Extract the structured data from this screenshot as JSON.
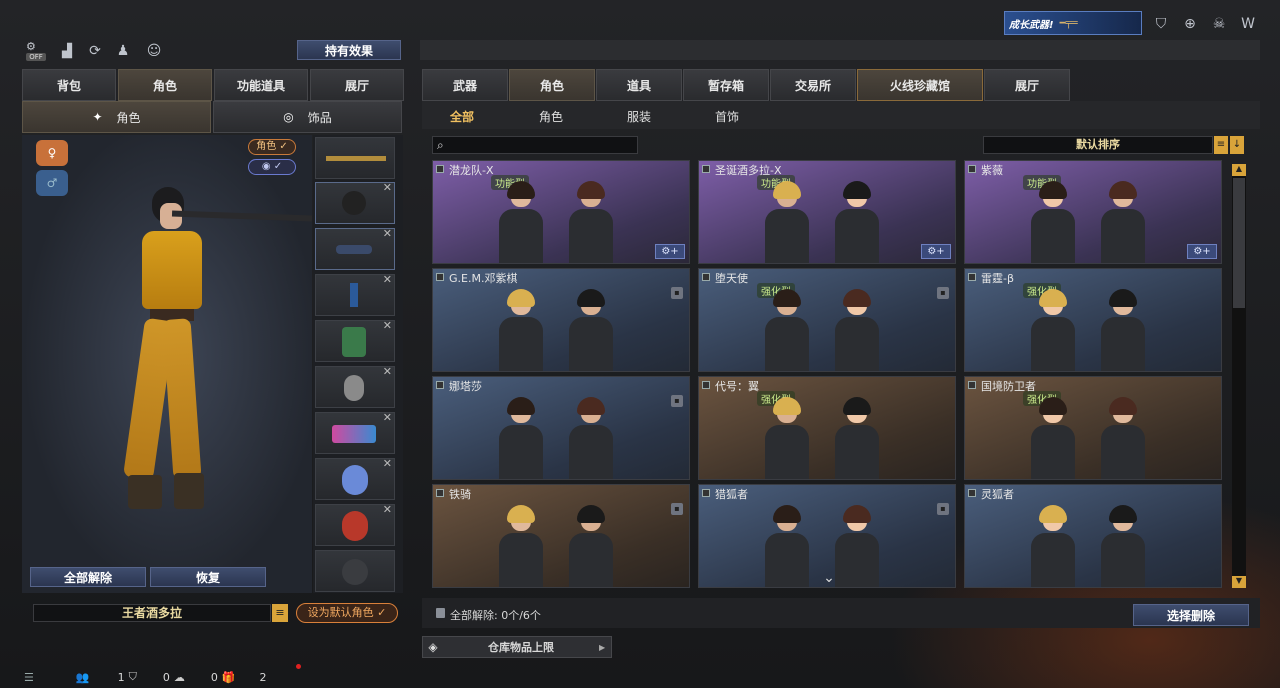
{
  "top_right": {
    "badge_text": "成长武器!"
  },
  "left_panel": {
    "effect_button": "持有效果",
    "off_label": "OFF",
    "tabs": [
      "背包",
      "角色",
      "功能道具",
      "展厅"
    ],
    "sub_tabs": [
      "角色",
      "饰品"
    ],
    "preview_tags": {
      "role": "角色 ✓",
      "eye": "✓"
    },
    "unequip_all": "全部解除",
    "restore": "恢复",
    "character_name": "王者酒多拉",
    "set_default": "设为默认角色 ✓"
  },
  "right_panel": {
    "tabs": [
      "武器",
      "角色",
      "道具",
      "暂存箱",
      "交易所",
      "火线珍藏馆",
      "展厅"
    ],
    "sub_tabs": [
      "全部",
      "角色",
      "服装",
      "首饰"
    ],
    "search_placeholder": "",
    "sort_label": "默认排序",
    "cards": [
      {
        "name": "潜龙队-X",
        "tag": "功能型",
        "theme": "purple"
      },
      {
        "name": "圣诞酒多拉-X",
        "tag": "功能型",
        "theme": "purple"
      },
      {
        "name": "紫薇",
        "tag": "功能型",
        "theme": "purple"
      },
      {
        "name": "G.E.M.邓紫棋",
        "tag": "",
        "theme": "blue"
      },
      {
        "name": "堕天使",
        "tag": "强化型",
        "theme": "blue"
      },
      {
        "name": "雷霆-β",
        "tag": "强化型",
        "theme": "blue"
      },
      {
        "name": "娜塔莎",
        "tag": "",
        "theme": "blue"
      },
      {
        "name": "代号：翼",
        "tag": "强化型",
        "theme": "brown"
      },
      {
        "name": "国境防卫者",
        "tag": "强化型",
        "theme": "brown"
      },
      {
        "name": "铁骑",
        "tag": "",
        "theme": "brown"
      },
      {
        "name": "猎狐者",
        "tag": "",
        "theme": "blue"
      },
      {
        "name": "灵狐者",
        "tag": "",
        "theme": "blue"
      }
    ],
    "unequip_status": "全部解除:  0个/6个",
    "select_unequip": "选择删除",
    "storage_limit": "仓库物品上限"
  },
  "bottom_bar": {
    "count1": "1",
    "count2": "0",
    "count3": "0",
    "count4": "2"
  }
}
